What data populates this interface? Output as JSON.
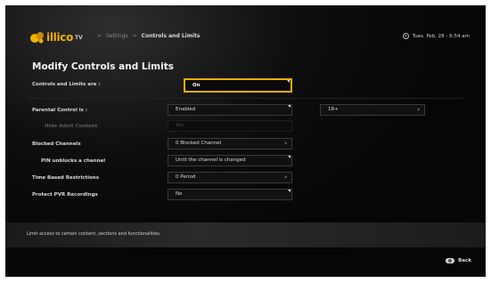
{
  "brand": {
    "name": "illico",
    "suffix": "TV"
  },
  "breadcrumb": {
    "items": [
      "Settings",
      "Controls and Limits"
    ],
    "separator": ">"
  },
  "datetime": "Tues. Feb. 28 - 6:54 am",
  "title": "Modify Controls and Limits",
  "rows": {
    "controls": {
      "label": "Controls and Limits are :",
      "value": "On"
    },
    "parental": {
      "label": "Parental Control is :",
      "value": "Enabled",
      "rating": "18+"
    },
    "hide_adult": {
      "label": "Hide Adult Content",
      "value": "Yes"
    },
    "blocked": {
      "label": "Blocked Channels",
      "value": "0 Blocked Channel"
    },
    "pin": {
      "label": "PIN unblocks a channel",
      "value": "Until the channel is changed"
    },
    "time": {
      "label": "Time Based Restrictions",
      "value": "0 Period"
    },
    "pvr": {
      "label": "Protect PVR Recordings",
      "value": "No"
    }
  },
  "footer": {
    "description": "Limit access to certain content, sections and functionalities.",
    "back_label": "Back"
  },
  "colors": {
    "accent": "#f0b000",
    "background": "#060606"
  },
  "icons": [
    "illico-logo-icon",
    "clock-icon",
    "chevron-right-icon",
    "chevron-down-icon",
    "back-button-icon"
  ]
}
